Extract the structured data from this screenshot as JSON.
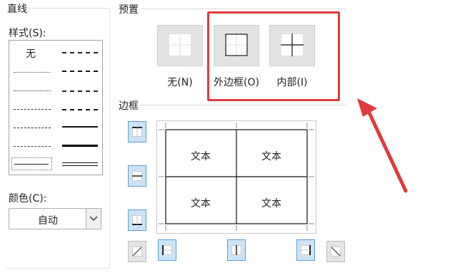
{
  "line_group": {
    "title": "直线",
    "style_label": "样式(S):",
    "style_hotkey": "S",
    "none_option": "无",
    "color_label": "颜色(C):",
    "color_value": "自动"
  },
  "preset_group": {
    "title": "预置",
    "buttons": [
      {
        "label": "无(N)",
        "icon": "border-none-icon"
      },
      {
        "label": "外边框(O)",
        "icon": "border-outline-icon"
      },
      {
        "label": "内部(I)",
        "icon": "border-inside-icon"
      }
    ]
  },
  "border_group": {
    "title": "边框",
    "cells": [
      "文本",
      "文本",
      "文本",
      "文本"
    ]
  },
  "colors": {
    "annotation": "#e03a3e",
    "active_button": "#cce4f7",
    "active_border": "#5d9bd3"
  }
}
